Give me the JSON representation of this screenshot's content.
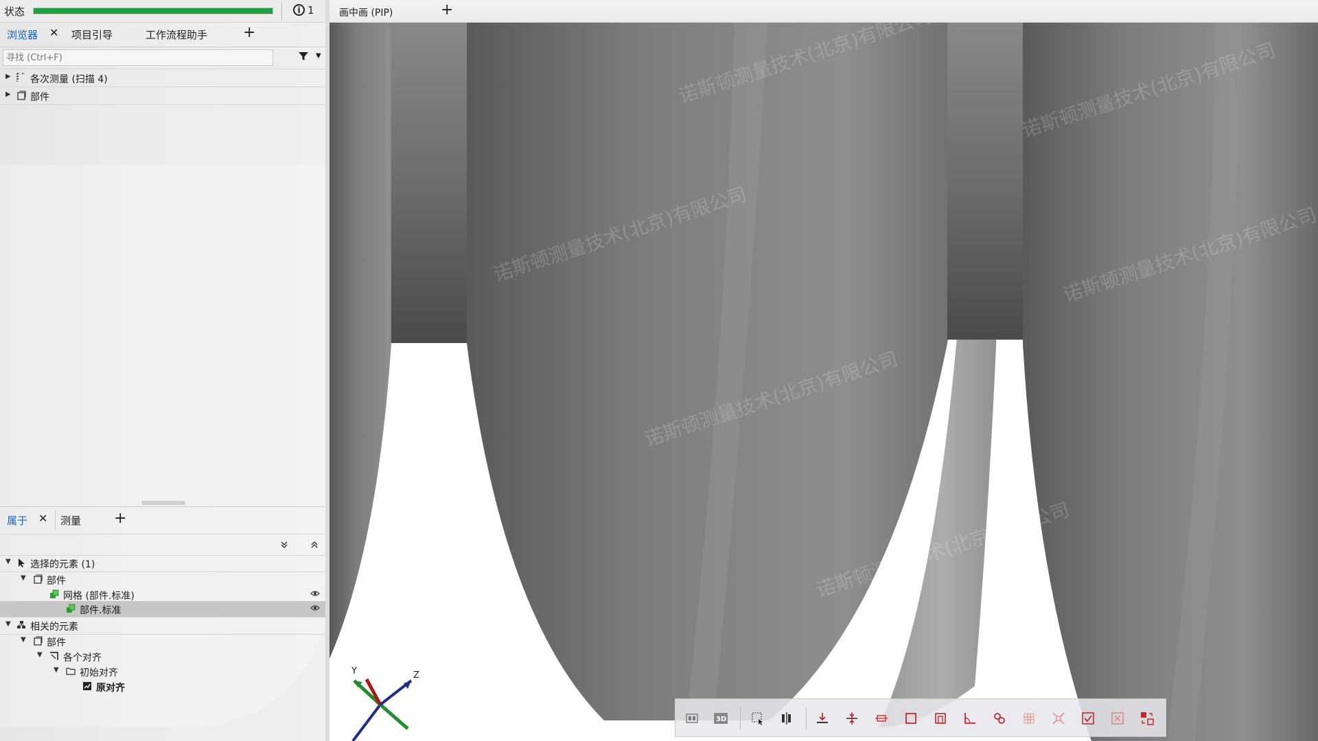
{
  "status": {
    "label": "状态",
    "progress_percent": 100,
    "info_count": "1"
  },
  "top_tabs": [
    {
      "label": "浏览器",
      "active": true,
      "closable": true
    },
    {
      "label": "项目引导",
      "active": false
    },
    {
      "label": "工作流程助手",
      "active": false
    }
  ],
  "add_tab": "+",
  "search": {
    "placeholder": "寻找 (Ctrl+F)"
  },
  "explorer_tree": [
    {
      "label": "各次测量 (扫描 4)",
      "icon": "measurement-series-icon"
    },
    {
      "label": "部件",
      "icon": "part-icon"
    }
  ],
  "bottom_tabs": [
    {
      "label": "属于",
      "active": true,
      "closable": true
    },
    {
      "label": "测量",
      "active": false
    }
  ],
  "properties_tree": {
    "selected": {
      "label": "选择的元素 (1)",
      "icon": "cursor-arrow-icon"
    },
    "selected_part": {
      "label": "部件",
      "icon": "part-icon"
    },
    "mesh": {
      "label": "网格 (部件.标准)",
      "icon": "mesh-icon"
    },
    "mesh_child": {
      "label": "部件.标准",
      "icon": "mesh-icon"
    },
    "related": {
      "label": "相关的元素",
      "icon": "related-elements-icon"
    },
    "related_part": {
      "label": "部件",
      "icon": "part-icon"
    },
    "alignments": {
      "label": "各个对齐",
      "icon": "alignment-icon"
    },
    "initial_alignment": {
      "label": "初始对齐",
      "icon": "folder-icon"
    },
    "original_alignment": {
      "label": "原对齐",
      "icon": "original-alignment-icon"
    }
  },
  "viewport": {
    "tab_label": "画中画 (PIP)",
    "add_tab": "+",
    "watermark": "诺斯顿测量技术(北京)有限公司",
    "axes": {
      "x": "",
      "y": "Y",
      "z": "Z"
    }
  },
  "view_toolbar": [
    "2d-view-icon",
    "3d-view-icon",
    "selection-icon",
    "split-view-icon",
    "align-bottom-icon",
    "align-center-icon",
    "fit-width-icon",
    "rectangle-icon",
    "frame-icon",
    "angle-icon",
    "link-icon",
    "grid-select-icon",
    "shrink-icon",
    "check-icon",
    "close-box-icon",
    "transform-icon"
  ],
  "colors": {
    "accent": "#1565c0",
    "progress": "#23a043",
    "toolbar_icon": "#c62828",
    "mesh_green": "#2e9e2e"
  }
}
